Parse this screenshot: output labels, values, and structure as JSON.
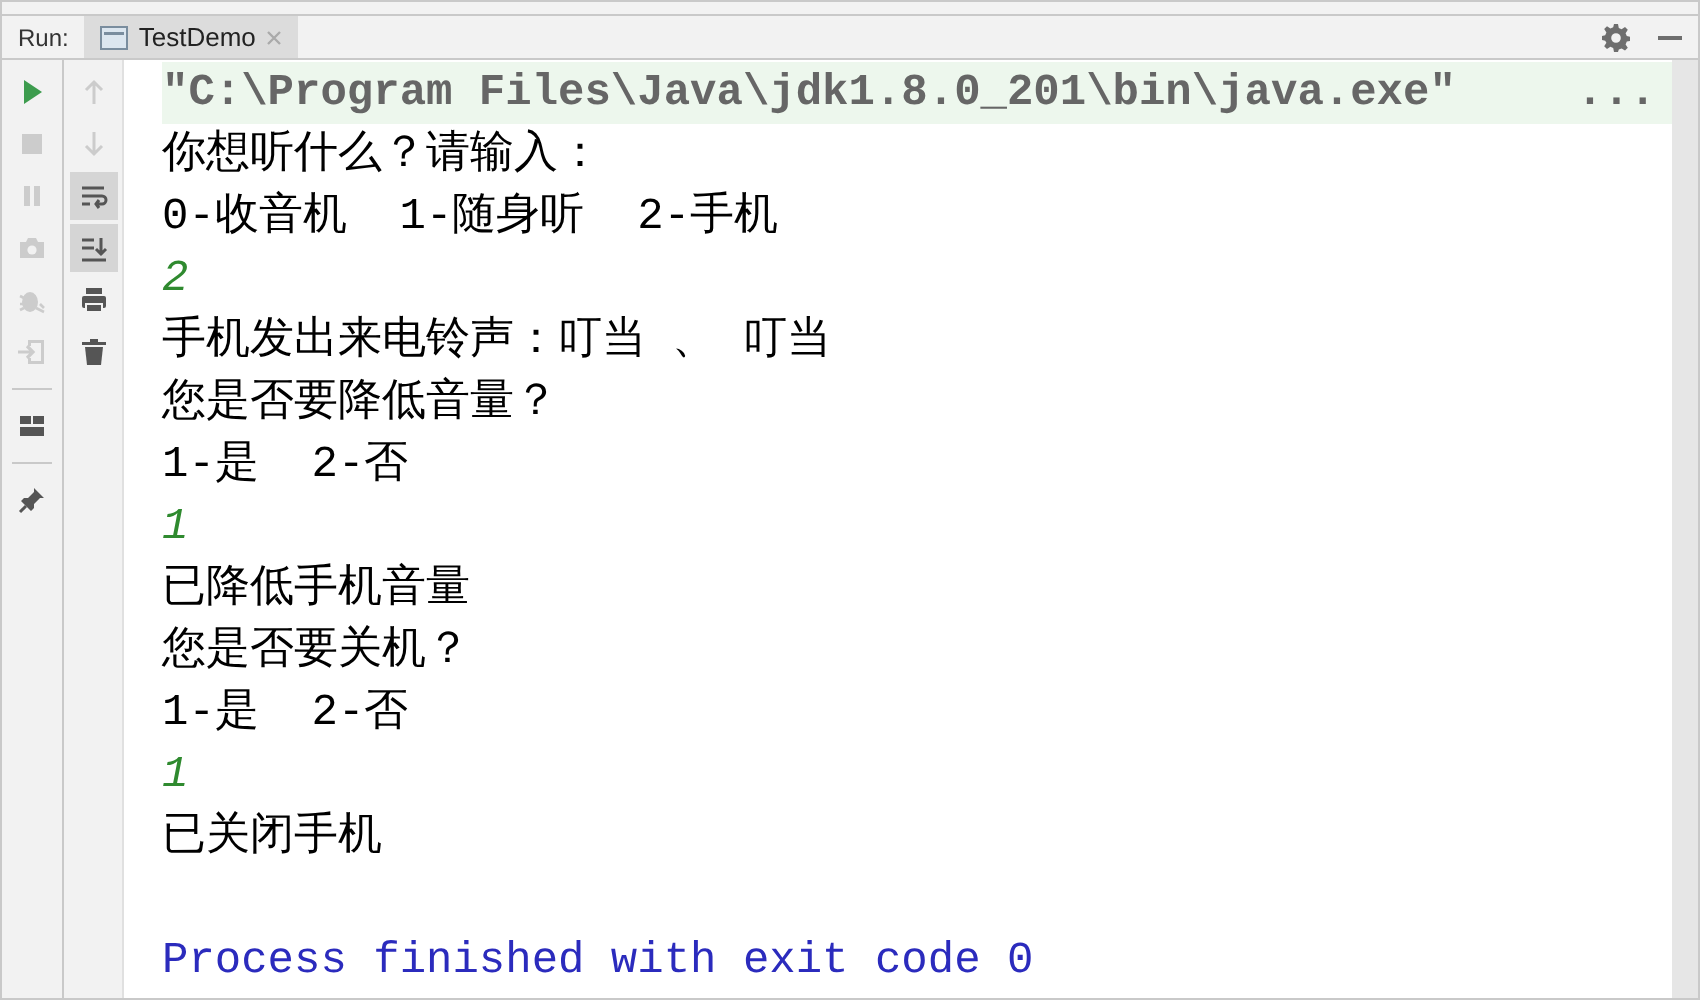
{
  "run_bar": {
    "label": "Run:",
    "tab": {
      "title": "TestDemo",
      "selected": true
    }
  },
  "left_toolbar": [
    {
      "kind": "run",
      "disabled": false
    },
    {
      "kind": "stop",
      "disabled": true
    },
    {
      "kind": "pause",
      "disabled": true
    },
    {
      "kind": "camera",
      "disabled": true
    },
    {
      "kind": "bug",
      "disabled": true
    },
    {
      "kind": "exit",
      "disabled": true
    },
    {
      "kind": "sep"
    },
    {
      "kind": "layout",
      "disabled": false
    },
    {
      "kind": "sep"
    },
    {
      "kind": "pin",
      "disabled": false
    }
  ],
  "second_toolbar": [
    {
      "kind": "up",
      "disabled": true,
      "selected": false
    },
    {
      "kind": "down",
      "disabled": true,
      "selected": false
    },
    {
      "kind": "wrap",
      "disabled": false,
      "selected": true
    },
    {
      "kind": "scroll",
      "disabled": false,
      "selected": true
    },
    {
      "kind": "print",
      "disabled": false,
      "selected": false
    },
    {
      "kind": "trash",
      "disabled": false,
      "selected": false
    }
  ],
  "console": [
    {
      "kind": "command",
      "text": "\"C:\\Program Files\\Java\\jdk1.8.0_201\\bin\\java.exe\"",
      "more": "..."
    },
    {
      "kind": "output",
      "text": "你想听什么？请输入："
    },
    {
      "kind": "output",
      "text": "0-收音机  1-随身听  2-手机"
    },
    {
      "kind": "input",
      "text": "2"
    },
    {
      "kind": "output",
      "text": "手机发出来电铃声：叮当 、 叮当"
    },
    {
      "kind": "output",
      "text": "您是否要降低音量？"
    },
    {
      "kind": "output",
      "text": "1-是  2-否"
    },
    {
      "kind": "input",
      "text": "1"
    },
    {
      "kind": "output",
      "text": "已降低手机音量"
    },
    {
      "kind": "output",
      "text": "您是否要关机？"
    },
    {
      "kind": "output",
      "text": "1-是  2-否"
    },
    {
      "kind": "input",
      "text": "1"
    },
    {
      "kind": "output",
      "text": "已关闭手机"
    },
    {
      "kind": "blank"
    },
    {
      "kind": "exit",
      "text": "Process finished with exit code 0"
    }
  ]
}
